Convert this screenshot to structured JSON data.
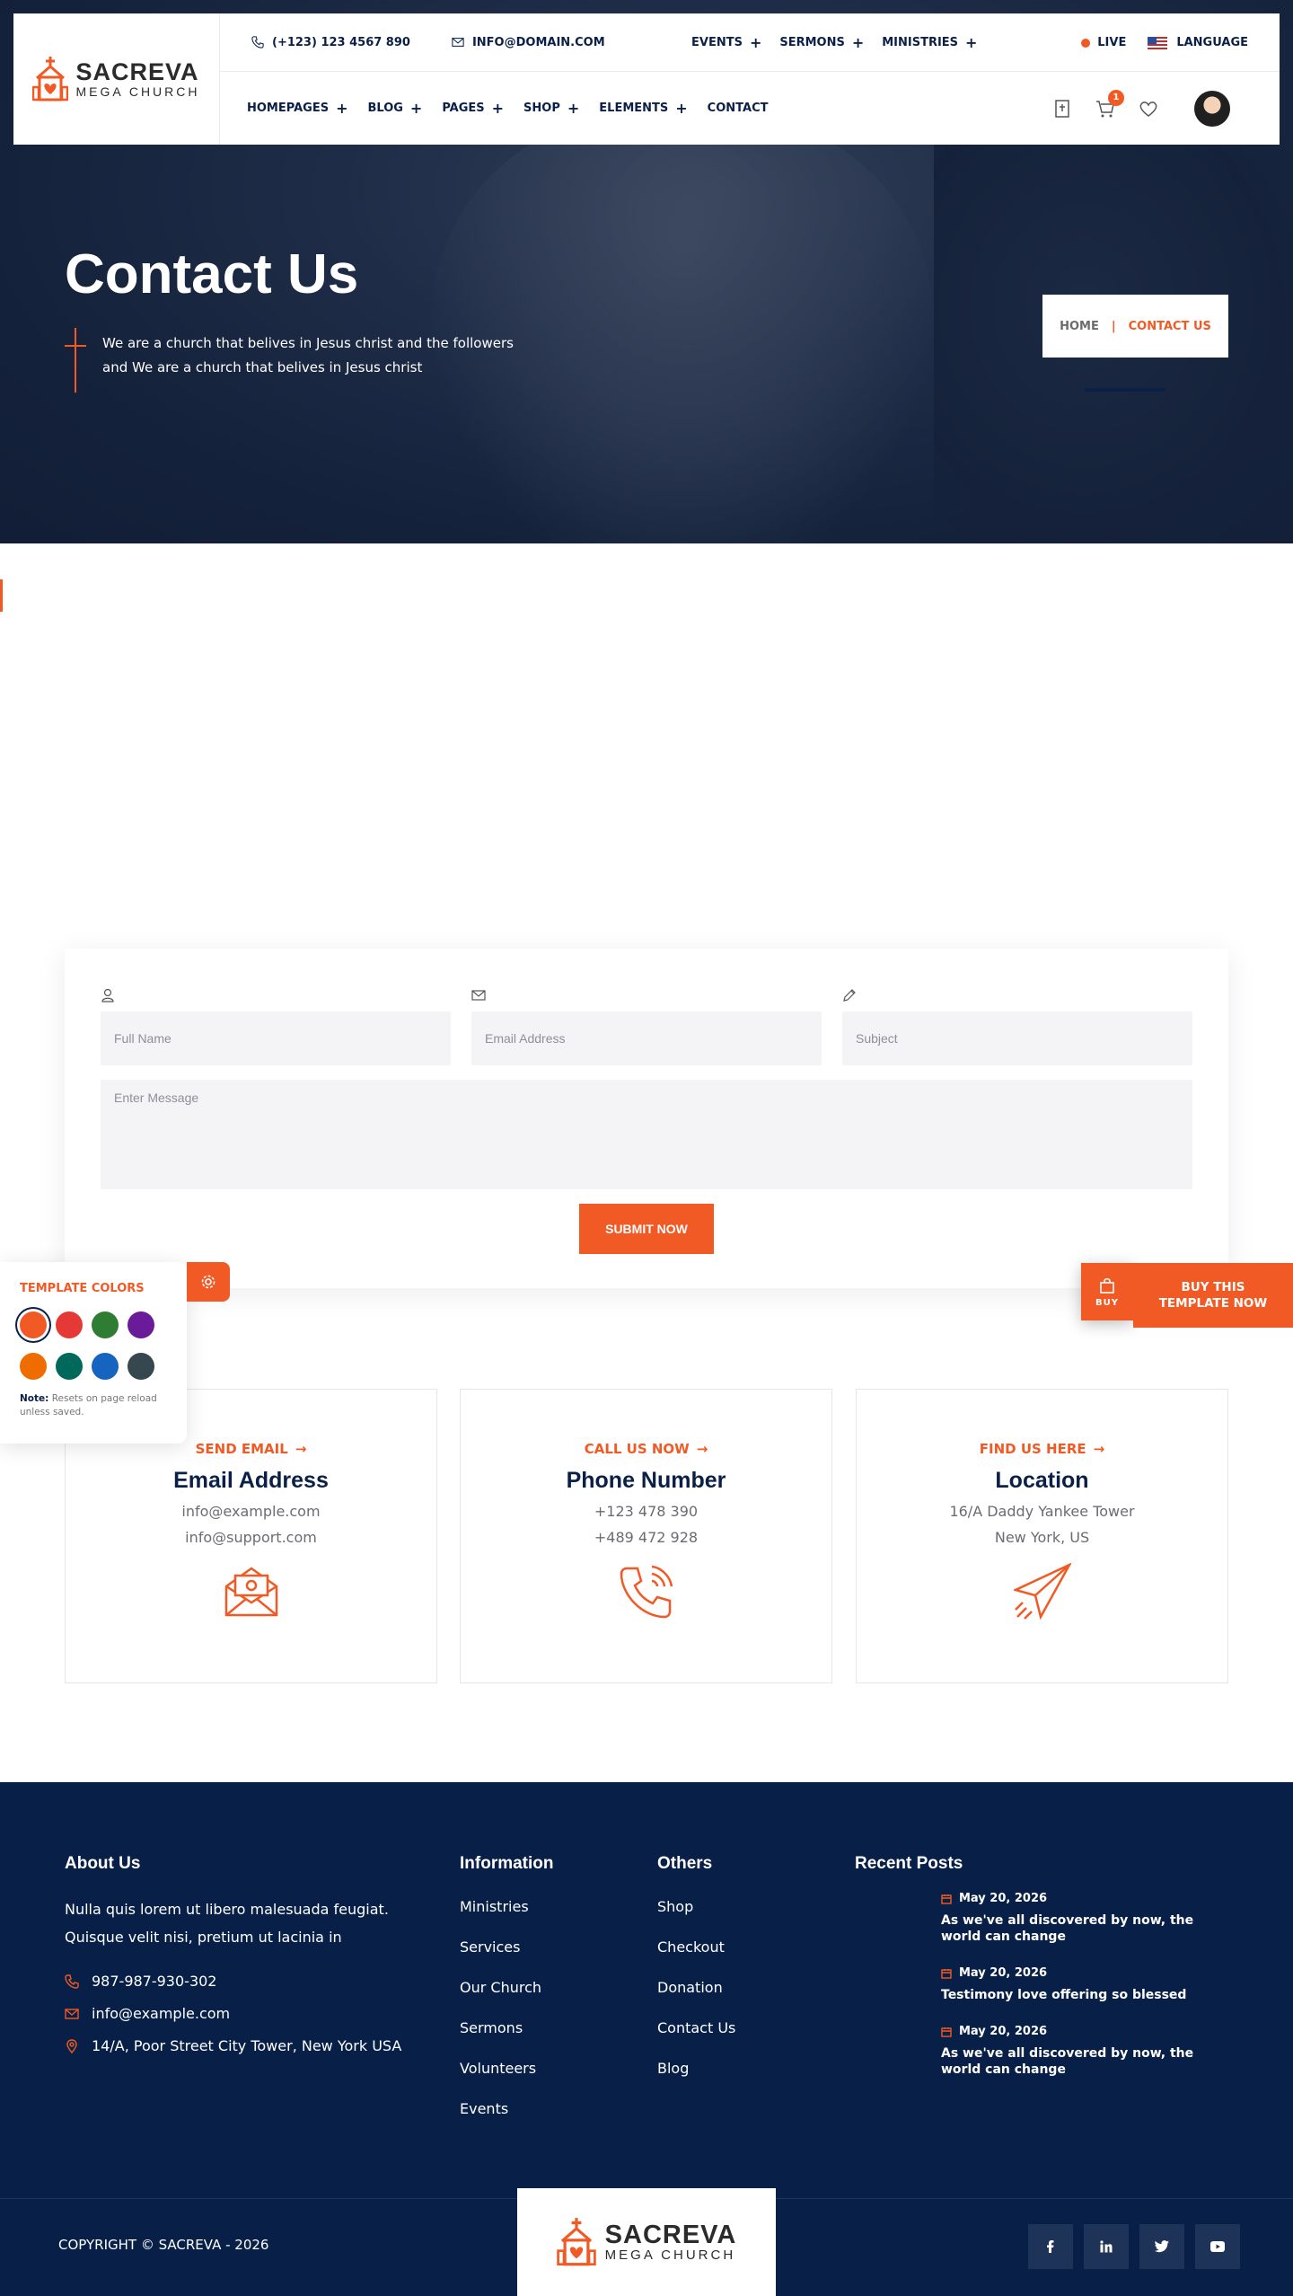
{
  "brand": {
    "name": "SACREVA",
    "tagline": "MEGA CHURCH",
    "accent": "#f15a24",
    "navy": "#0b2049"
  },
  "topbar": {
    "phone": "(+123) 123 4567 890",
    "email": "INFO@DOMAIN.COM",
    "menu": [
      "EVENTS",
      "SERMONS",
      "MINISTRIES"
    ],
    "live": "LIVE",
    "language": "LANGUAGE"
  },
  "nav": {
    "items": [
      "HOMEPAGES",
      "BLOG",
      "PAGES",
      "SHOP",
      "ELEMENTS",
      "CONTACT"
    ],
    "cart_count": "1"
  },
  "hero": {
    "title": "Contact Us",
    "description": "We are a church that belives in Jesus christ and the followers and We are a church that belives in Jesus christ",
    "breadcrumb": {
      "home": "HOME",
      "separator": "|",
      "current": "CONTACT US"
    }
  },
  "form": {
    "name_placeholder": "Full Name",
    "email_placeholder": "Email Address",
    "subject_placeholder": "Subject",
    "message_placeholder": "Enter Message",
    "submit_label": "SUBMIT NOW"
  },
  "template_colors": {
    "title": "TEMPLATE COLORS",
    "swatches": [
      "#f15a24",
      "#e53935",
      "#2e7d32",
      "#6a1b9a",
      "#ef6c00",
      "#00695c",
      "#1565c0",
      "#37474f"
    ],
    "note_label": "Note:",
    "note_text": "Resets on page reload unless saved."
  },
  "buy": {
    "icon_label": "BUY",
    "label": "BUY THIS TEMPLATE NOW"
  },
  "info_cards": [
    {
      "label": "SEND EMAIL",
      "title": "Email Address",
      "lines": [
        "info@example.com",
        "info@support.com"
      ],
      "icon": "envelope-at-icon"
    },
    {
      "label": "CALL US NOW",
      "title": "Phone Number",
      "lines": [
        "+123 478 390",
        "+489 472 928"
      ],
      "icon": "phone-ringing-icon"
    },
    {
      "label": "FIND US HERE",
      "title": "Location",
      "lines": [
        "16/A Daddy Yankee Tower",
        "New York, US"
      ],
      "icon": "paper-plane-icon"
    }
  ],
  "footer": {
    "about_title": "About Us",
    "about_text": "Nulla quis lorem ut libero malesuada feugiat. Quisque velit nisi, pretium ut lacinia in",
    "phone": "987-987-930-302",
    "email": "info@example.com",
    "address": "14/A, Poor Street City Tower, New York USA",
    "information_title": "Information",
    "information_links": [
      "Ministries",
      "Services",
      "Our Church",
      "Sermons",
      "Volunteers",
      "Events"
    ],
    "others_title": "Others",
    "others_links": [
      "Shop",
      "Checkout",
      "Donation",
      "Contact Us",
      "Blog"
    ],
    "recent_title": "Recent Posts",
    "recent_posts": [
      {
        "date": "May 20, 2026",
        "title": "As we've all discovered by now, the world can change"
      },
      {
        "date": "May 20, 2026",
        "title": "Testimony love offering so blessed"
      },
      {
        "date": "May 20, 2026",
        "title": "As we've all discovered by now, the world can change"
      }
    ],
    "copyright": "COPYRIGHT © SACREVA - 2026",
    "socials": [
      "f",
      "in",
      "t",
      "yt"
    ]
  }
}
